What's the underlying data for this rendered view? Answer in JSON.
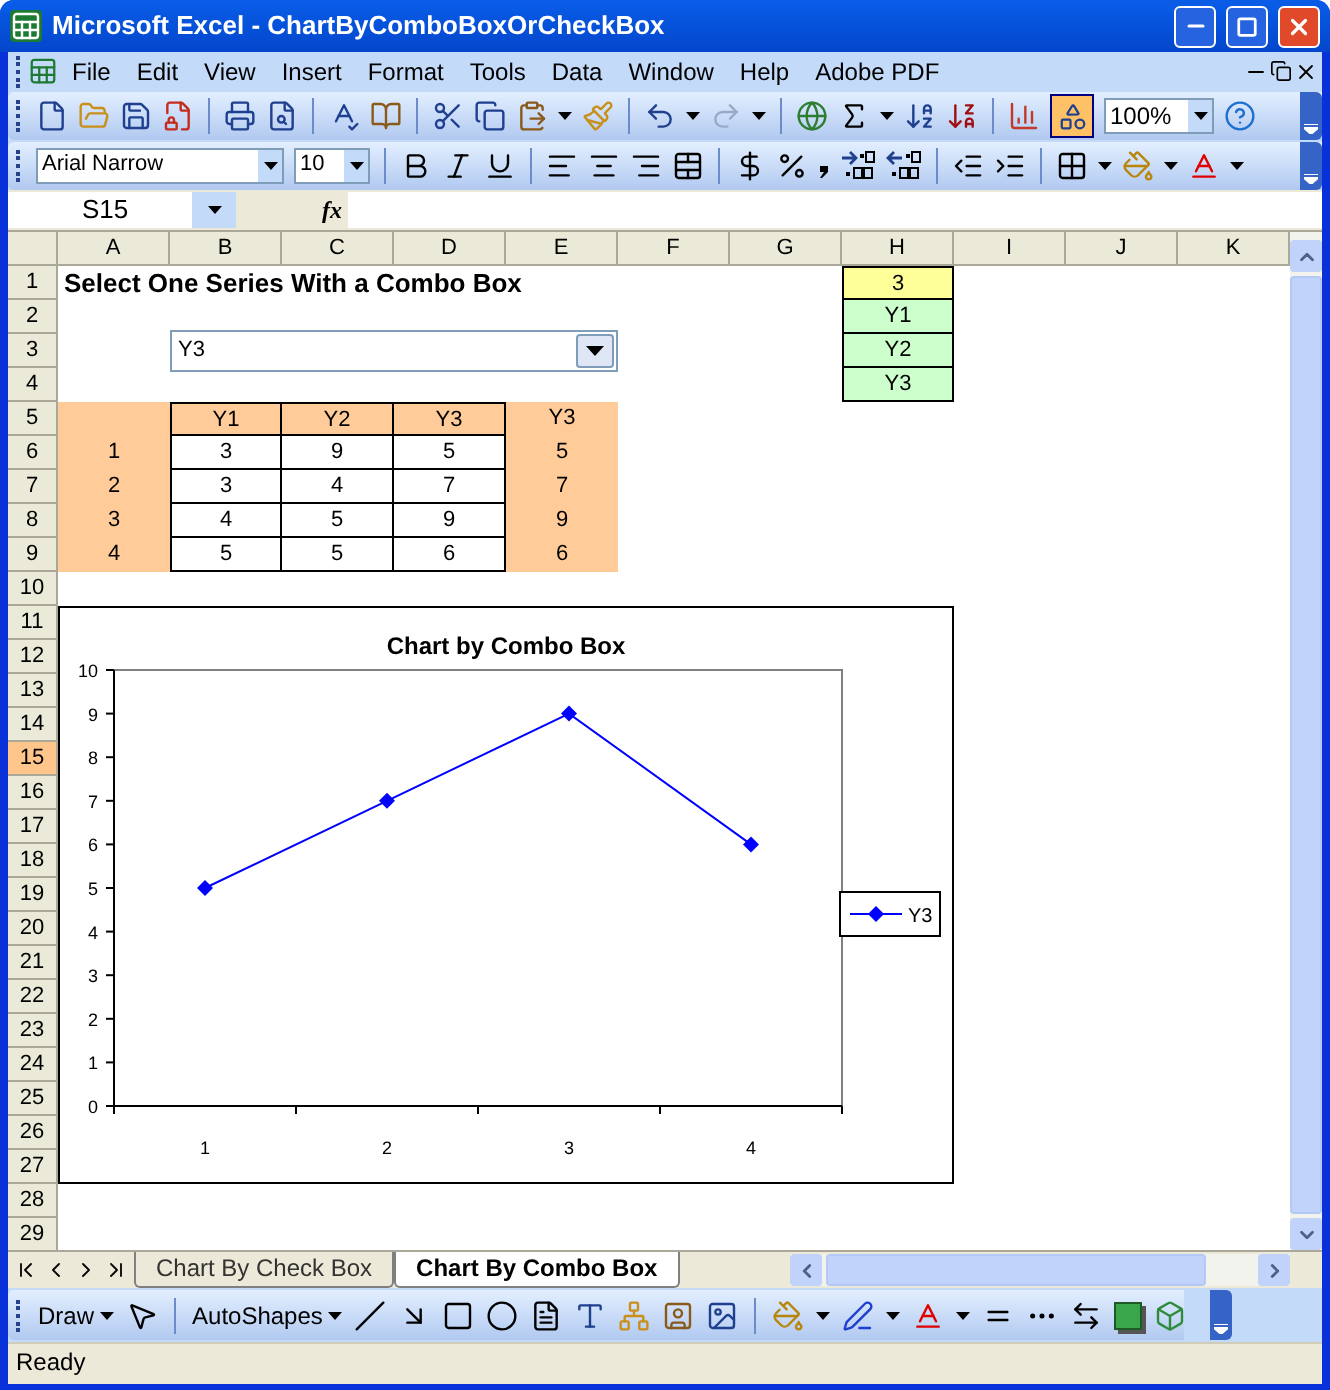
{
  "window": {
    "title": "Microsoft Excel - ChartByComboBoxOrCheckBox"
  },
  "menu": [
    "File",
    "Edit",
    "View",
    "Insert",
    "Format",
    "Tools",
    "Data",
    "Window",
    "Help",
    "Adobe PDF"
  ],
  "standard_toolbar": {
    "redo_disabled": true,
    "drawing_on": true,
    "zoom": "100%"
  },
  "formatting_toolbar": {
    "font": "Arial Narrow",
    "size": "10"
  },
  "formula_bar": {
    "name_box": "S15",
    "label": "fx"
  },
  "sheet": {
    "columns": [
      {
        "label": "A",
        "selected": false
      },
      {
        "label": "B",
        "selected": false
      },
      {
        "label": "C",
        "selected": false
      },
      {
        "label": "D",
        "selected": false
      },
      {
        "label": "E",
        "selected": false
      },
      {
        "label": "F",
        "selected": false
      },
      {
        "label": "G",
        "selected": false
      },
      {
        "label": "H",
        "selected": false
      },
      {
        "label": "I",
        "selected": false
      },
      {
        "label": "J",
        "selected": false
      },
      {
        "label": "K",
        "selected": false
      }
    ],
    "rows": [
      {
        "label": "1",
        "selected": false
      },
      {
        "label": "2",
        "selected": false
      },
      {
        "label": "3",
        "selected": false
      },
      {
        "label": "4",
        "selected": false
      },
      {
        "label": "5",
        "selected": false
      },
      {
        "label": "6",
        "selected": false
      },
      {
        "label": "7",
        "selected": false
      },
      {
        "label": "8",
        "selected": false
      },
      {
        "label": "9",
        "selected": false
      },
      {
        "label": "10",
        "selected": false
      },
      {
        "label": "11",
        "selected": false
      },
      {
        "label": "12",
        "selected": false
      },
      {
        "label": "13",
        "selected": false
      },
      {
        "label": "14",
        "selected": false
      },
      {
        "label": "15",
        "selected": true
      },
      {
        "label": "16",
        "selected": false
      },
      {
        "label": "17",
        "selected": false
      },
      {
        "label": "18",
        "selected": false
      },
      {
        "label": "19",
        "selected": false
      },
      {
        "label": "20",
        "selected": false
      },
      {
        "label": "21",
        "selected": false
      },
      {
        "label": "22",
        "selected": false
      },
      {
        "label": "23",
        "selected": false
      },
      {
        "label": "24",
        "selected": false
      },
      {
        "label": "25",
        "selected": false
      },
      {
        "label": "26",
        "selected": false
      },
      {
        "label": "27",
        "selected": false
      },
      {
        "label": "28",
        "selected": false
      },
      {
        "label": "29",
        "selected": false
      }
    ],
    "title": "Select One Series With a Combo Box",
    "combo_box": {
      "value": "Y3"
    },
    "lookup": [
      {
        "text": "3",
        "kind": "index"
      },
      {
        "text": "Y1",
        "kind": "option"
      },
      {
        "text": "Y2",
        "kind": "option"
      },
      {
        "text": "Y3",
        "kind": "option"
      }
    ],
    "table": {
      "header": [
        "Y1",
        "Y2",
        "Y3"
      ],
      "result_header": "Y3",
      "rows": [
        {
          "label": "1",
          "values": [
            "3",
            "9",
            "5"
          ],
          "result": "5"
        },
        {
          "label": "2",
          "values": [
            "3",
            "4",
            "7"
          ],
          "result": "7"
        },
        {
          "label": "3",
          "values": [
            "4",
            "5",
            "9"
          ],
          "result": "9"
        },
        {
          "label": "4",
          "values": [
            "5",
            "5",
            "6"
          ],
          "result": "6"
        }
      ]
    },
    "chart": {
      "chart_data": {
        "type": "line",
        "title": "Chart by Combo Box",
        "categories": [
          "1",
          "2",
          "3",
          "4"
        ],
        "series": [
          {
            "name": "Y3",
            "color": "#0000ff",
            "marker": "diamond",
            "values": [
              5,
              7,
              9,
              6
            ]
          }
        ],
        "ylim": [
          0,
          10
        ],
        "yticks": [
          0,
          1,
          2,
          3,
          4,
          5,
          6,
          7,
          8,
          9,
          10
        ]
      }
    }
  },
  "sheet_tabs": [
    {
      "label": "Chart By Check Box",
      "selected": false
    },
    {
      "label": "Chart By Combo Box",
      "selected": true
    }
  ],
  "drawing_toolbar": {
    "draw": "Draw",
    "autoshapes": "AutoShapes"
  },
  "status_bar": {
    "text": "Ready"
  }
}
